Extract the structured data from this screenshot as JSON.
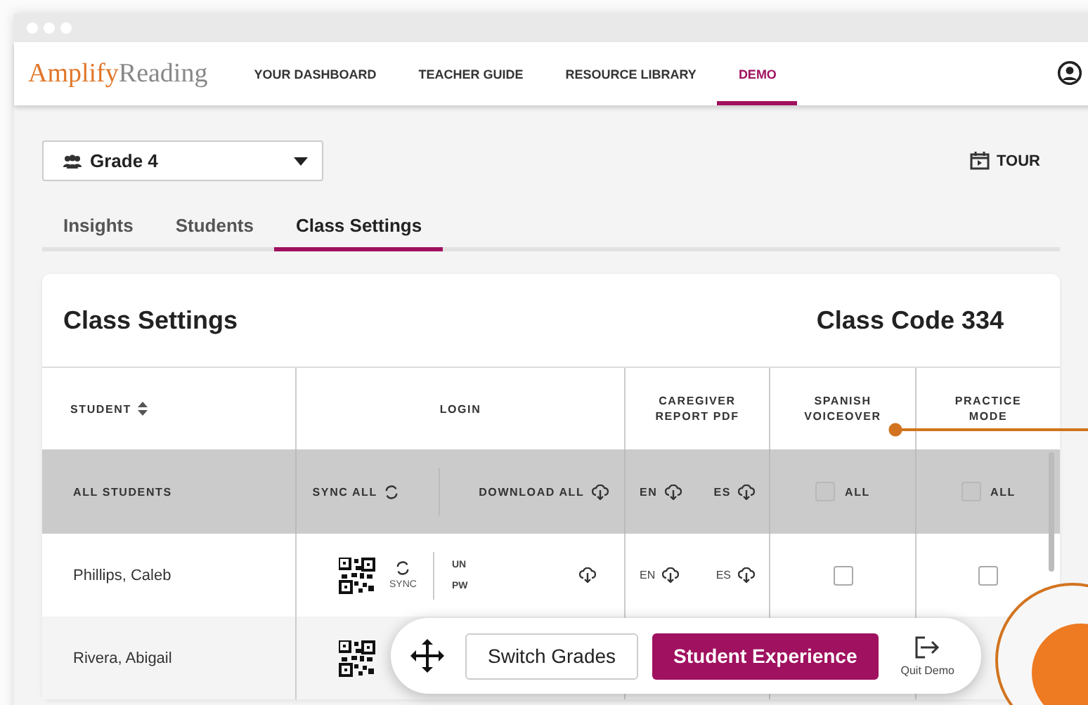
{
  "nav": {
    "logo": {
      "brand": "Amplify",
      "product": "Reading"
    },
    "items": [
      {
        "label": "YOUR DASHBOARD",
        "selected": false
      },
      {
        "label": "TEACHER GUIDE",
        "selected": false
      },
      {
        "label": "RESOURCE LIBRARY",
        "selected": false
      },
      {
        "label": "DEMO",
        "selected": true
      }
    ]
  },
  "grade_selector": {
    "value": "Grade 4"
  },
  "tour": "TOUR",
  "tabs": [
    {
      "label": "Insights",
      "selected": false
    },
    {
      "label": "Students",
      "selected": false
    },
    {
      "label": "Class Settings",
      "selected": true
    }
  ],
  "card": {
    "title": "Class Settings",
    "class_code": "Class Code 334"
  },
  "columns": {
    "student": "STUDENT",
    "login": "LOGIN",
    "caregiver": "CAREGIVER REPORT PDF",
    "spanish": "SPANISH VOICEOVER",
    "practice": "PRACTICE MODE"
  },
  "all_row": {
    "label": "ALL STUDENTS",
    "sync_all": "SYNC ALL",
    "download_all": "DOWNLOAD ALL",
    "en": "EN",
    "es": "ES",
    "spanish_all": {
      "label": "ALL",
      "checked": false
    },
    "practice_all": {
      "label": "ALL",
      "checked": false
    }
  },
  "rows": [
    {
      "name": "Phillips, Caleb",
      "sync": "SYNC",
      "un": "UN",
      "pw": "PW",
      "en": "EN",
      "es": "ES",
      "spanish_voiceover": false,
      "practice_mode": false
    },
    {
      "name": "Rivera, Abigail"
    }
  ],
  "toolbar": {
    "switch": "Switch Grades",
    "student": "Student Experience",
    "quit": "Quit Demo"
  }
}
